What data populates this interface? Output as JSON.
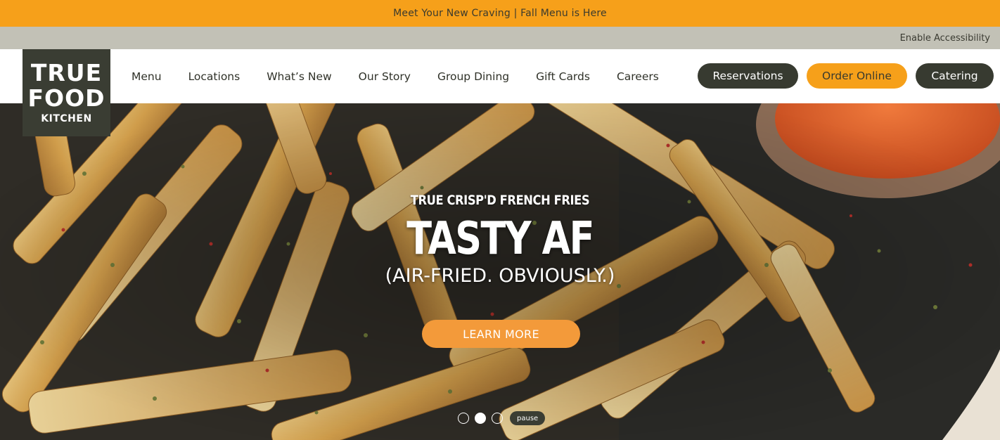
{
  "promo": {
    "text": "Meet Your New Craving | Fall Menu is Here"
  },
  "utility": {
    "accessibility_label": "Enable Accessibility"
  },
  "logo": {
    "line1": "TRUE",
    "line2": "FOOD",
    "line3": "KITCHEN"
  },
  "nav": {
    "items": [
      {
        "label": "Menu"
      },
      {
        "label": "Locations"
      },
      {
        "label": "What’s New"
      },
      {
        "label": "Our Story"
      },
      {
        "label": "Group Dining"
      },
      {
        "label": "Gift Cards"
      },
      {
        "label": "Careers"
      }
    ]
  },
  "cta": {
    "reservations": "Reservations",
    "order_online": "Order Online",
    "catering": "Catering"
  },
  "hero": {
    "eyebrow": "TRUE CRISP'D FRENCH FRIES",
    "headline": "TASTY AF",
    "subline": "(AIR-FRIED. OBVIOUSLY.)",
    "button": "LEARN MORE",
    "slides_total": 3,
    "active_slide": 2,
    "pause_label": "pause"
  },
  "colors": {
    "accent_orange": "#f6a01a",
    "dark_olive": "#373a30",
    "utility_gray": "#c2c1b6",
    "hero_button": "#f39a3a"
  }
}
